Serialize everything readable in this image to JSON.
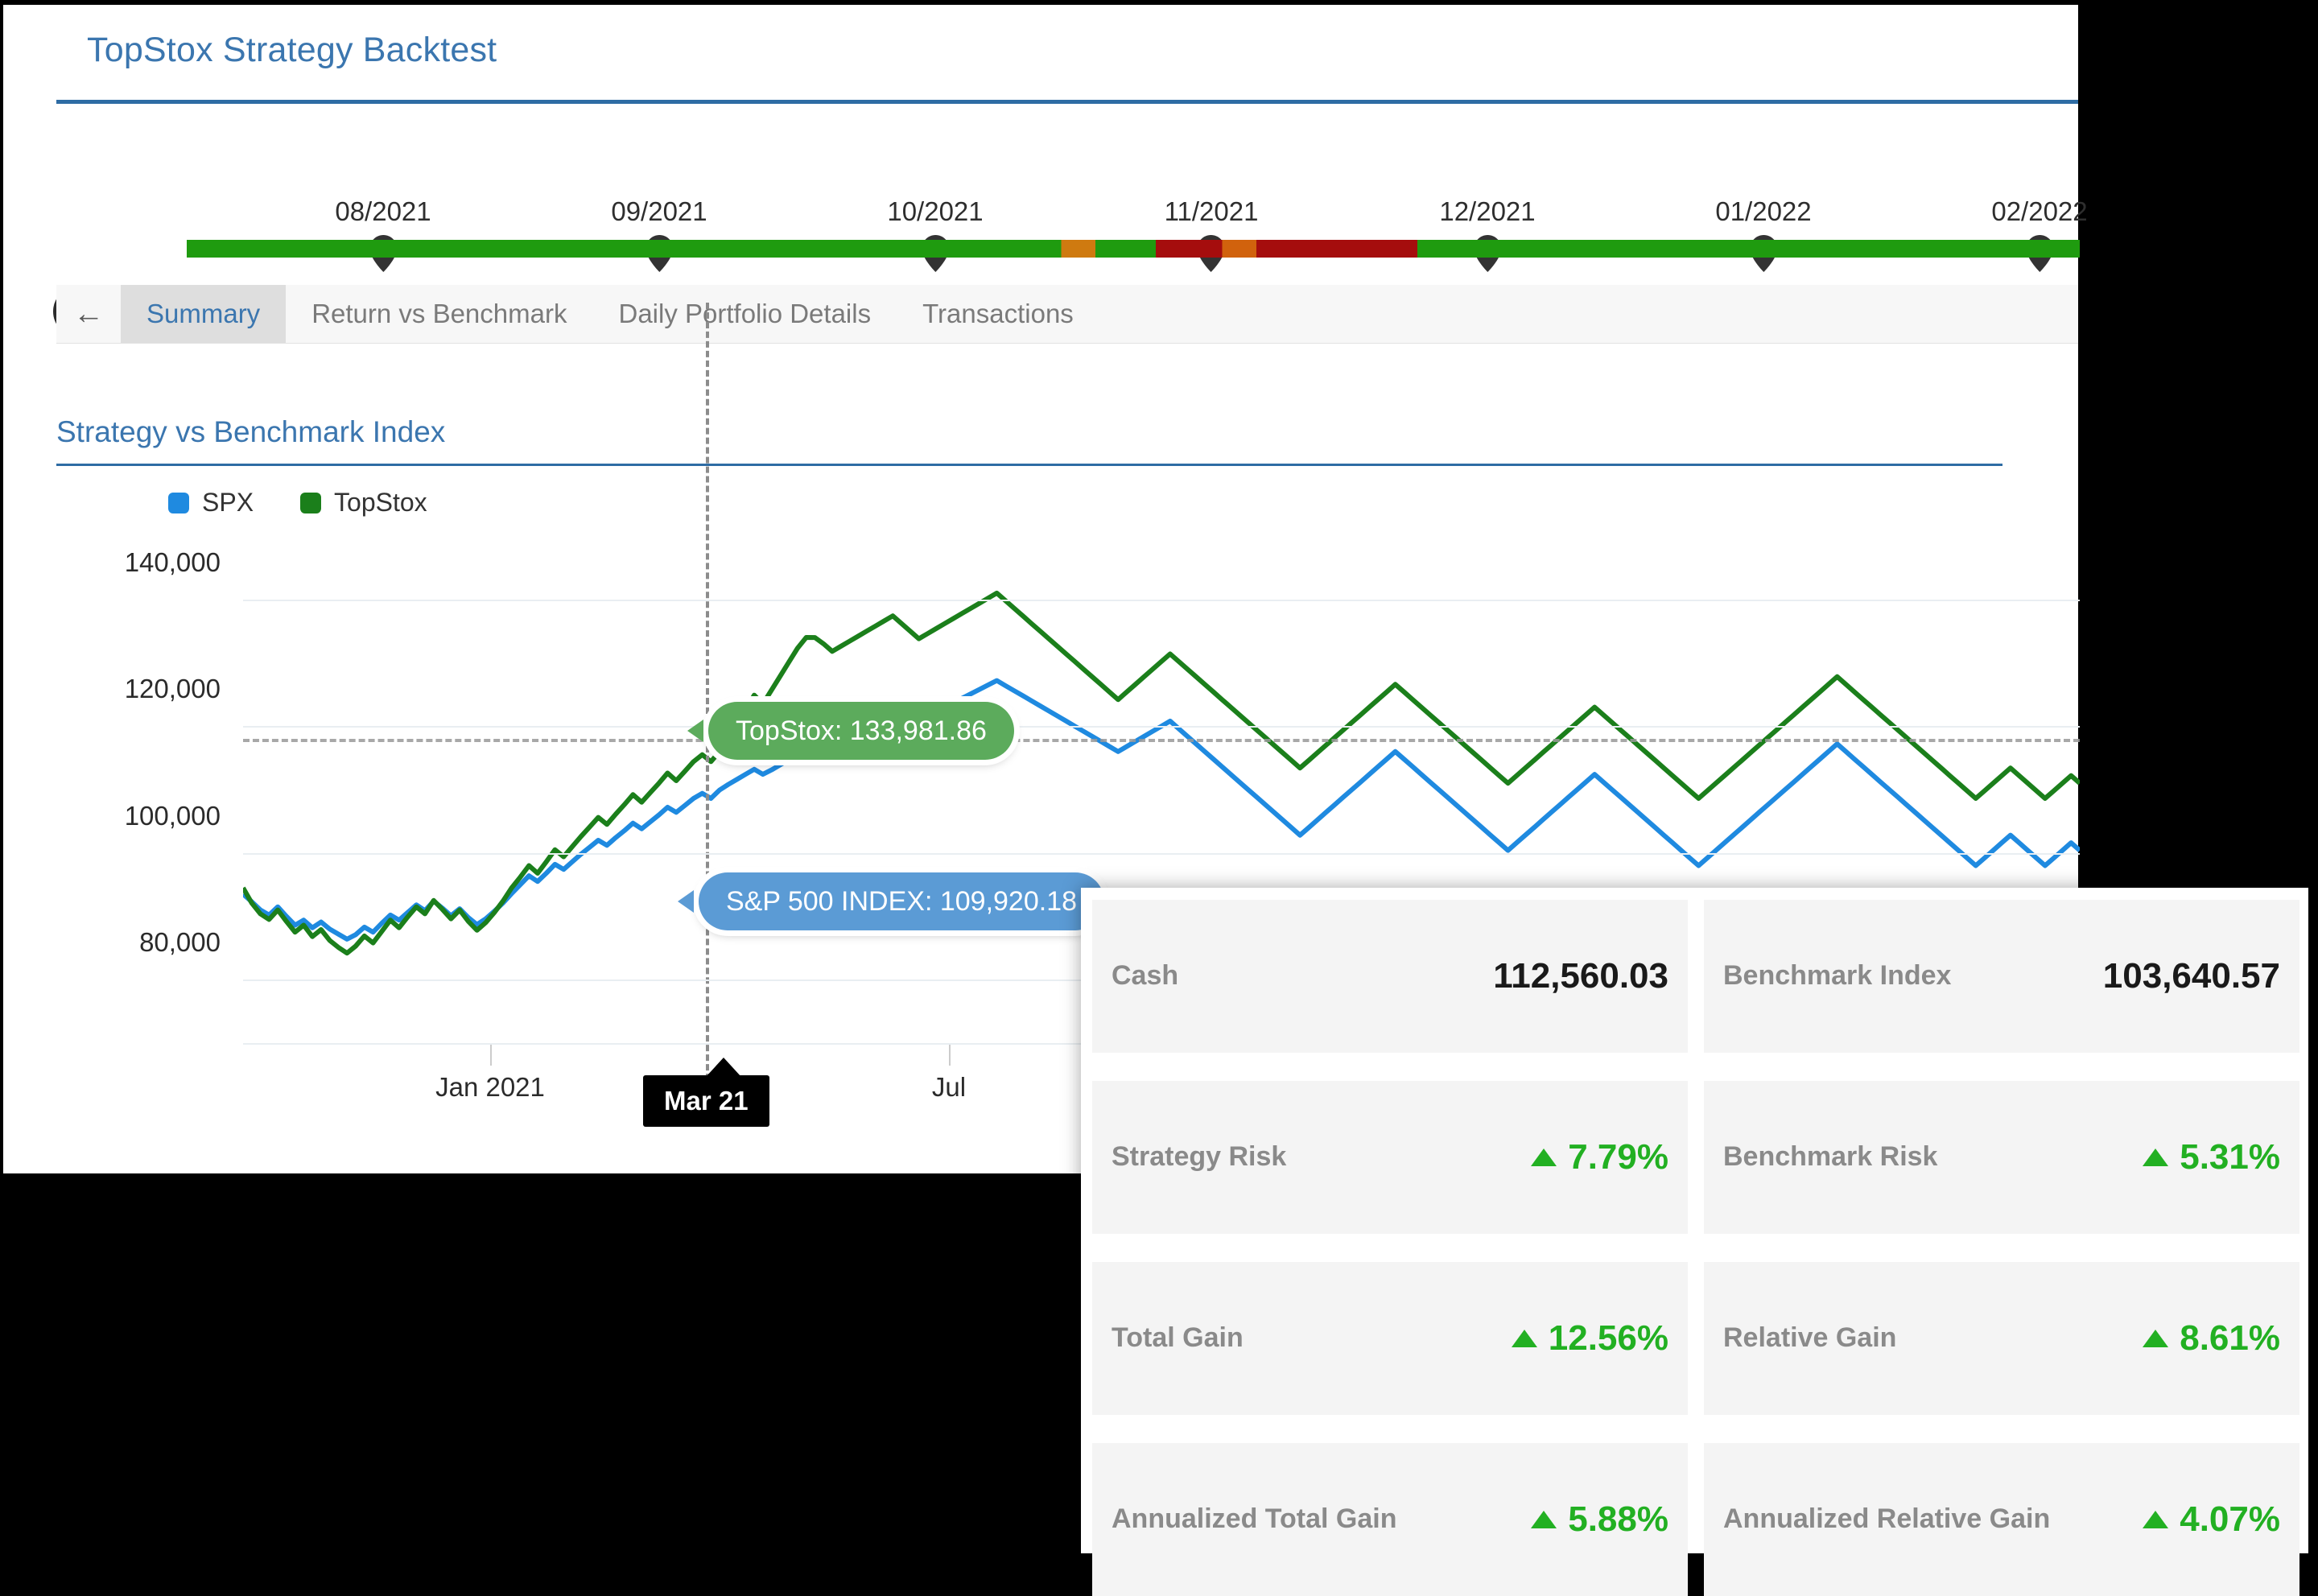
{
  "header": {
    "title": "TopStox Strategy Backtest",
    "accent": "#2e6ca4"
  },
  "timeline": {
    "nav_first_label": "«",
    "nav_prev_label": "‹",
    "ticks": [
      "08/2021",
      "09/2021",
      "10/2021",
      "11/2021",
      "12/2021",
      "01/2022",
      "02/2022"
    ],
    "segments": [
      {
        "color": "#1f9b0f",
        "start": 0.0,
        "end": 0.462
      },
      {
        "color": "#cf7a10",
        "start": 0.462,
        "end": 0.48
      },
      {
        "color": "#1f9b0f",
        "start": 0.48,
        "end": 0.512
      },
      {
        "color": "#a50d0d",
        "start": 0.512,
        "end": 0.547
      },
      {
        "color": "#d1620d",
        "start": 0.547,
        "end": 0.565
      },
      {
        "color": "#a50d0d",
        "start": 0.565,
        "end": 0.65
      },
      {
        "color": "#1f9b0f",
        "start": 0.65,
        "end": 1.0
      }
    ]
  },
  "tabs": {
    "back_label": "←",
    "items": [
      {
        "label": "Summary",
        "active": true
      },
      {
        "label": "Return vs Benchmark",
        "active": false
      },
      {
        "label": "Daily Portfolio Details",
        "active": false
      },
      {
        "label": "Transactions",
        "active": false
      }
    ]
  },
  "chart_section": {
    "title": "Strategy vs Benchmark Index"
  },
  "chart_data": {
    "type": "line",
    "title": "Strategy vs Benchmark Index",
    "xlabel": "",
    "ylabel": "",
    "ylim": [
      70000,
      150000
    ],
    "yticks": [
      140000,
      120000,
      100000,
      80000
    ],
    "ytick_labels": [
      "140,000",
      "120,000",
      "100,000",
      "80,000"
    ],
    "xtick_labels": [
      "Jan 2021",
      "Jul"
    ],
    "grid": true,
    "legend_position": "top-left",
    "legend": [
      {
        "name": "SPX",
        "color": "#1f8ae0"
      },
      {
        "name": "TopStox",
        "color": "#1b7f1b"
      }
    ],
    "cursor": {
      "x_label": "Mar 21",
      "reference_line_value": 118000,
      "points": [
        {
          "series": "TopStox",
          "label": "TopStox: 133,981.86",
          "value": 133981.86,
          "color": "#5cab5c"
        },
        {
          "series": "SPX",
          "label": "S&P 500 INDEX: 109,920.18",
          "value": 109920.18,
          "color": "#5b9bd5"
        }
      ]
    },
    "series": [
      {
        "name": "SPX",
        "color": "#1f8ae0",
        "values": [
          93500,
          92300,
          91000,
          90200,
          91500,
          90000,
          88600,
          89400,
          88200,
          89100,
          88000,
          87200,
          86400,
          87100,
          88300,
          87500,
          88900,
          90200,
          89400,
          90600,
          91800,
          90900,
          92400,
          91300,
          90100,
          91200,
          89800,
          88700,
          89600,
          90800,
          92100,
          93600,
          95000,
          96400,
          95500,
          96800,
          98200,
          97400,
          98600,
          99800,
          100900,
          102000,
          101200,
          102400,
          103500,
          104700,
          103800,
          104900,
          106000,
          107200,
          106400,
          107500,
          108600,
          109400,
          108600,
          109920,
          110800,
          111600,
          112400,
          113200,
          112400,
          113100,
          113900,
          114700,
          115400,
          116100,
          116900,
          117600,
          118300,
          119100,
          119800,
          120500,
          121200,
          121900,
          122600,
          123300,
          122500,
          121700,
          120900,
          121600,
          122300,
          123000,
          123700,
          124400,
          125100,
          125800,
          126500,
          127200,
          126400,
          125600,
          124800,
          124000,
          123200,
          122400,
          121600,
          120800,
          120000,
          119200,
          118400,
          117600,
          116800,
          116000,
          116800,
          117600,
          118400,
          119200,
          120000,
          120800,
          119600,
          118400,
          117200,
          116000,
          114800,
          113600,
          112400,
          111200,
          110000,
          108800,
          107600,
          106400,
          105200,
          104000,
          102800,
          104000,
          105200,
          106400,
          107600,
          108800,
          110000,
          111200,
          112400,
          113600,
          114800,
          116000,
          114800,
          113600,
          112400,
          111200,
          110000,
          108800,
          107600,
          106400,
          105200,
          104000,
          102800,
          101600,
          100400,
          101600,
          102800,
          104000,
          105200,
          106400,
          107600,
          108800,
          110000,
          111200,
          112400,
          111200,
          110000,
          108800,
          107600,
          106400,
          105200,
          104000,
          102800,
          101600,
          100400,
          99200,
          98000,
          99200,
          100400,
          101600,
          102800,
          104000,
          105200,
          106400,
          107600,
          108800,
          110000,
          111200,
          112400,
          113600,
          114800,
          116000,
          117200,
          116000,
          114800,
          113600,
          112400,
          111200,
          110000,
          108800,
          107600,
          106400,
          105200,
          104000,
          102800,
          101600,
          100400,
          99200,
          98000,
          99200,
          100400,
          101600,
          102800,
          101600,
          100400,
          99200,
          98000,
          99200,
          100400,
          101600,
          100400
        ]
      },
      {
        "name": "TopStox",
        "color": "#1b7f1b",
        "values": [
          94500,
          92100,
          90400,
          89500,
          91000,
          89200,
          87500,
          88600,
          86800,
          87900,
          86200,
          85100,
          84200,
          85300,
          86900,
          85800,
          87600,
          89400,
          88200,
          89900,
          91500,
          90400,
          92500,
          91100,
          89600,
          91000,
          89200,
          87800,
          89000,
          90600,
          92400,
          94500,
          96200,
          98000,
          96800,
          98600,
          100500,
          99400,
          101000,
          102600,
          104100,
          105600,
          104500,
          106100,
          107600,
          109200,
          108000,
          109500,
          111000,
          112600,
          111400,
          112900,
          114400,
          115500,
          114400,
          116000,
          118200,
          120400,
          122600,
          124900,
          123500,
          125700,
          127900,
          130100,
          132300,
          134000,
          133981,
          133000,
          131800,
          132600,
          133400,
          134200,
          135000,
          135800,
          136600,
          137400,
          136200,
          135000,
          133800,
          134600,
          135400,
          136200,
          137000,
          137800,
          138600,
          139400,
          140200,
          141000,
          139800,
          138600,
          137400,
          136200,
          135000,
          133800,
          132600,
          131400,
          130200,
          129000,
          127800,
          126600,
          125400,
          124200,
          125400,
          126600,
          127800,
          129000,
          130200,
          131400,
          130200,
          129000,
          127800,
          126600,
          125400,
          124200,
          123000,
          121800,
          120600,
          119400,
          118200,
          117000,
          115800,
          114600,
          113400,
          114600,
          115800,
          117000,
          118200,
          119400,
          120600,
          121800,
          123000,
          124200,
          125400,
          126600,
          125400,
          124200,
          123000,
          121800,
          120600,
          119400,
          118200,
          117000,
          115800,
          114600,
          113400,
          112200,
          111000,
          112200,
          113400,
          114600,
          115800,
          117000,
          118200,
          119400,
          120600,
          121800,
          123000,
          121800,
          120600,
          119400,
          118200,
          117000,
          115800,
          114600,
          113400,
          112200,
          111000,
          109800,
          108600,
          109800,
          111000,
          112200,
          113400,
          114600,
          115800,
          117000,
          118200,
          119400,
          120600,
          121800,
          123000,
          124200,
          125400,
          126600,
          127800,
          126600,
          125400,
          124200,
          123000,
          121800,
          120600,
          119400,
          118200,
          117000,
          115800,
          114600,
          113400,
          112200,
          111000,
          109800,
          108600,
          109800,
          111000,
          112200,
          113400,
          112200,
          111000,
          109800,
          108600,
          109800,
          111000,
          112200,
          111000
        ]
      }
    ]
  },
  "stats": {
    "cards": [
      {
        "label": "Cash",
        "value": "112,560.03",
        "type": "amount"
      },
      {
        "label": "Benchmark Index",
        "value": "103,640.57",
        "type": "amount"
      },
      {
        "label": "Strategy Risk",
        "value": "7.79%",
        "type": "percent-up"
      },
      {
        "label": "Benchmark Risk",
        "value": "5.31%",
        "type": "percent-up"
      },
      {
        "label": "Total Gain",
        "value": "12.56%",
        "type": "percent-up"
      },
      {
        "label": "Relative Gain",
        "value": "8.61%",
        "type": "percent-up"
      },
      {
        "label": "Annualized Total Gain",
        "value": "5.88%",
        "type": "percent-up"
      },
      {
        "label": "Annualized Relative Gain",
        "value": "4.07%",
        "type": "percent-up"
      }
    ],
    "positive_color": "#22b022"
  }
}
